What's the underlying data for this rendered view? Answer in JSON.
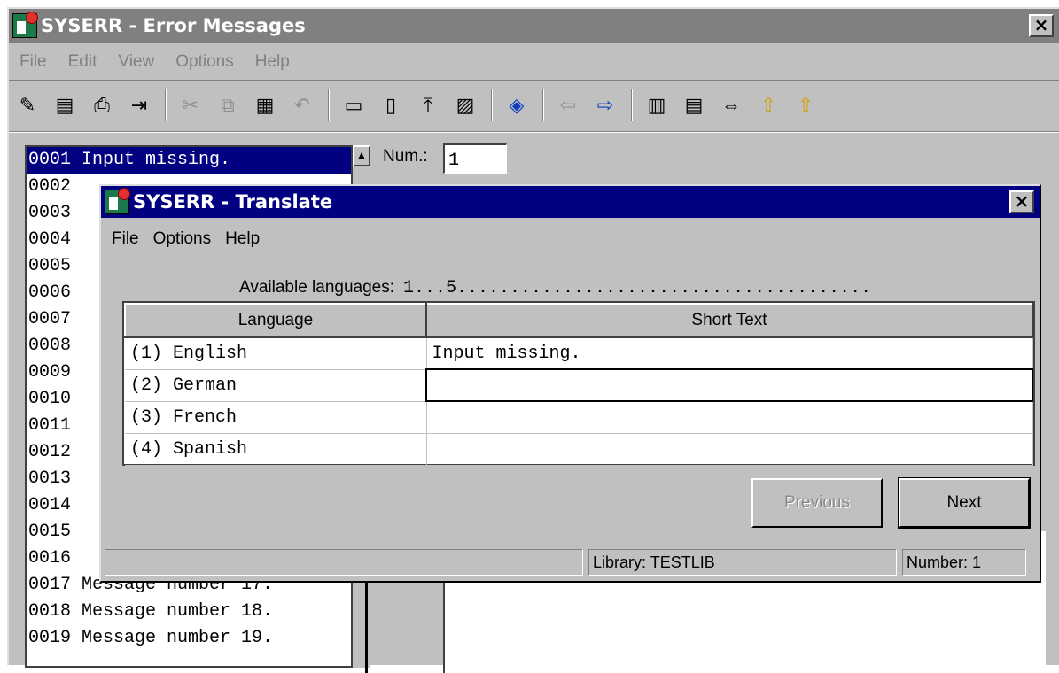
{
  "main_window": {
    "title": "SYSERR - Error Messages",
    "close_label": "×",
    "menu": [
      "File",
      "Edit",
      "View",
      "Options",
      "Help"
    ],
    "toolbar_icons": [
      "new-icon",
      "open-icon",
      "print-icon",
      "exit-icon",
      "cut-icon",
      "copy-icon",
      "paste-icon",
      "undo-icon",
      "doc1-icon",
      "doc2-icon",
      "export-icon",
      "edit-doc-icon",
      "find-icon",
      "back-icon",
      "forward-icon",
      "list1-icon",
      "list2-icon",
      "resize-icon",
      "upload1-icon",
      "upload2-icon"
    ],
    "num_label": "Num.:",
    "num_value": "1",
    "list_items": [
      "0001 Input missing.",
      "0002",
      "0003",
      "0004",
      "0005",
      "0006",
      "0007",
      "0008",
      "0009",
      "0010",
      "0011",
      "0012",
      "0013",
      "0014",
      "0015",
      "0016",
      "0017 Message number 17.",
      "0018 Message number 18.",
      "0019 Message number 19."
    ]
  },
  "dialog": {
    "title": "SYSERR - Translate",
    "close_label": "×",
    "menu": [
      "File",
      "Options",
      "Help"
    ],
    "available_label": "Available languages:",
    "available_value": "1...5.......................................",
    "table": {
      "headers": [
        "Language",
        "Short Text"
      ],
      "rows": [
        [
          "(1) English",
          "Input missing."
        ],
        [
          "(2) German",
          ""
        ],
        [
          "(3) French",
          ""
        ],
        [
          "(4) Spanish",
          ""
        ]
      ]
    },
    "previous_label": "Previous",
    "next_label": "Next",
    "status": {
      "library_label": "Library:",
      "library_value": "TESTLIB",
      "number_label": "Number:",
      "number_value": "1"
    }
  }
}
